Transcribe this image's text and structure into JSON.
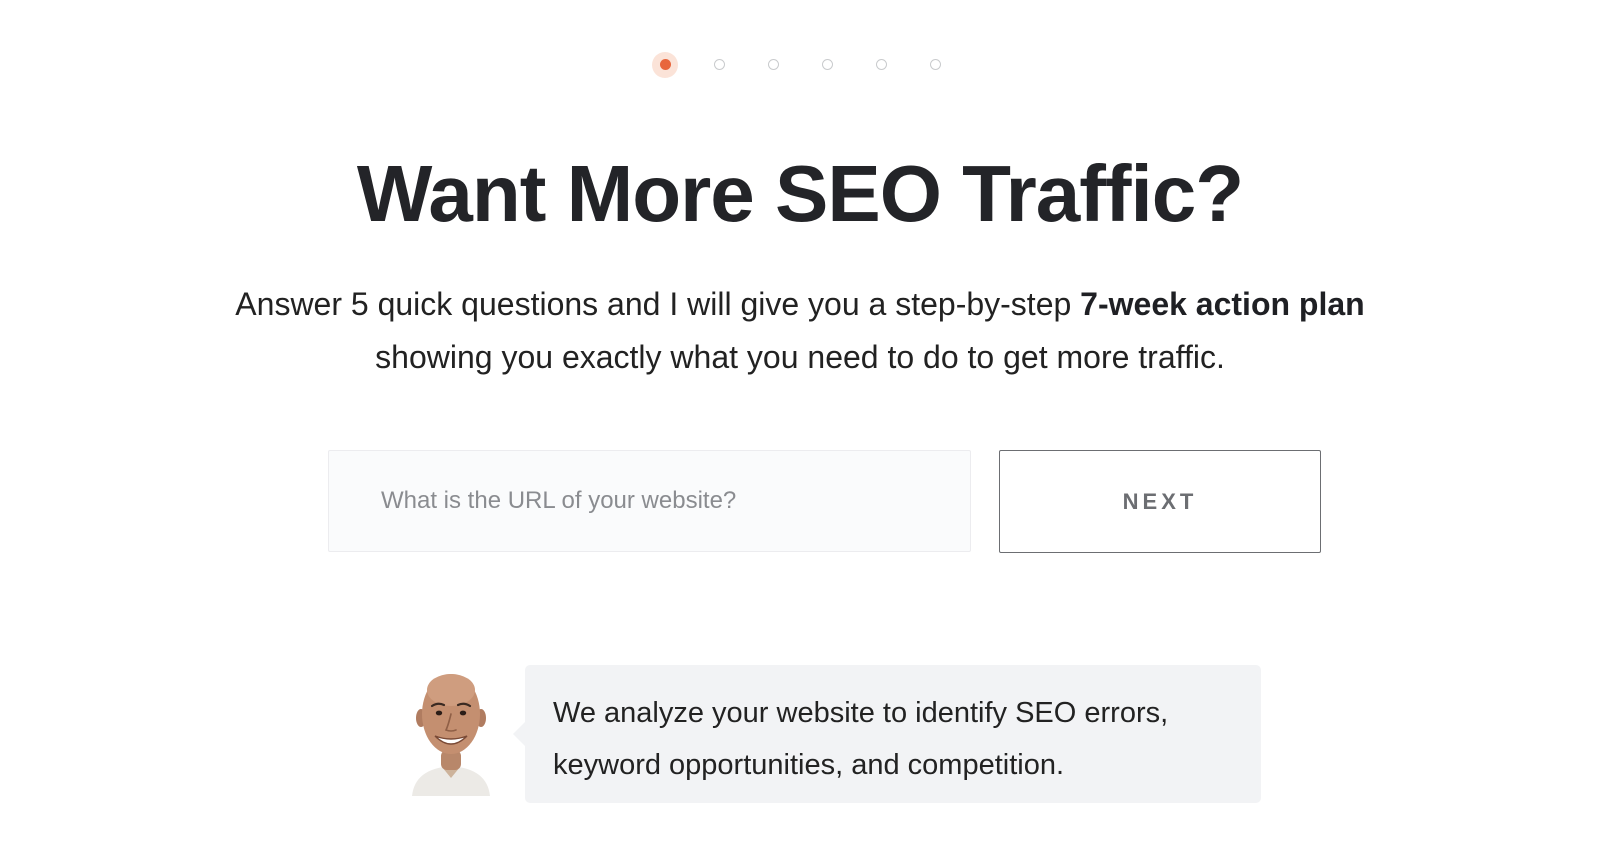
{
  "progress": {
    "total_steps": 6,
    "current_step": 1
  },
  "headline": "Want More SEO Traffic?",
  "subtitle": {
    "prefix": "Answer 5 quick questions and I will give you a step-by-step ",
    "emphasis": "7-week action plan",
    "suffix": " showing you exactly what you need to do to get more traffic."
  },
  "form": {
    "url_placeholder": "What is the URL of your website?",
    "url_value": "",
    "next_label": "NEXT"
  },
  "testimonial": {
    "text": "We analyze your website to identify SEO errors, keyword opportunities, and competition."
  },
  "colors": {
    "accent": "#e8663d",
    "accent_halo": "#fbe3d8",
    "heading": "#232428",
    "bubble_background": "#f2f3f5",
    "button_border": "#6c6e72"
  }
}
